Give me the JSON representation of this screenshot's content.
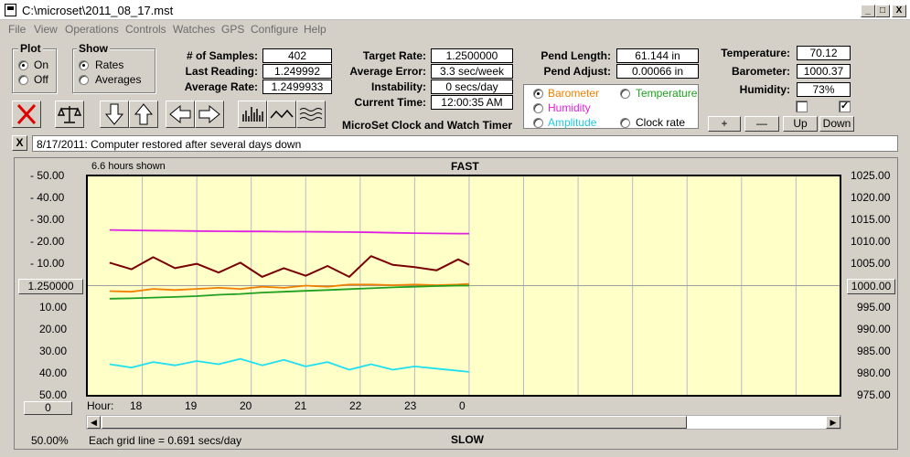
{
  "window": {
    "title": "C:\\microset\\2011_08_17.mst",
    "min": "_",
    "max": "□",
    "close": "X"
  },
  "menu": [
    "File",
    "View",
    "Operations",
    "Controls",
    "Watches",
    "GPS",
    "Configure",
    "Help"
  ],
  "plot_group": {
    "title": "Plot",
    "on": "On",
    "off": "Off",
    "selected": "On"
  },
  "show_group": {
    "title": "Show",
    "rates": "Rates",
    "averages": "Averages",
    "selected": "Rates"
  },
  "stats": {
    "samples_label": "# of Samples:",
    "samples": "402",
    "last_label": "Last Reading:",
    "last": "1.249992",
    "avg_label": "Average Rate:",
    "avg": "1.2499933"
  },
  "rates": {
    "target_label": "Target Rate:",
    "target": "1.2500000",
    "error_label": "Average Error:",
    "error": "3.3 sec/week",
    "instab_label": "Instability:",
    "instab": "0 secs/day",
    "time_label": "Current Time:",
    "time": "12:00:35 AM"
  },
  "app_name": "MicroSet Clock and Watch Timer",
  "pend": {
    "length_label": "Pend Length:",
    "length": "61.144 in",
    "adjust_label": "Pend Adjust:",
    "adjust": "0.00066 in"
  },
  "sensors": {
    "temp_label": "Temperature:",
    "temp": "70.12",
    "baro_label": "Barometer:",
    "baro": "1000.37",
    "humid_label": "Humidity:",
    "humid": "73%"
  },
  "overlay_options": {
    "barometer": "Barometer",
    "temperature": "Temperature",
    "humidity": "Humidity",
    "amplitude": "Amplitude",
    "clock_rate": "Clock rate",
    "selected": "Barometer"
  },
  "scale_buttons": {
    "plus": "+",
    "minus": "—",
    "up": "Up",
    "down": "Down"
  },
  "note": {
    "close": "X",
    "text": "8/17/2011: Computer restored after several days down"
  },
  "chart": {
    "hours_shown": "6.6 hours shown",
    "fast": "FAST",
    "slow": "SLOW",
    "center_rate": "1.250000",
    "center_baro": "1000.00",
    "left_ticks": [
      "-  50.00",
      "-  40.00",
      "-  30.00",
      "-  20.00",
      "-  10.00",
      "10.00",
      "20.00",
      "30.00",
      "40.00",
      "50.00"
    ],
    "right_ticks": [
      "1025.00",
      "1020.00",
      "1015.00",
      "1010.00",
      "1005.00",
      "995.00",
      "990.00",
      "985.00",
      "980.00",
      "975.00"
    ],
    "hour_label": "Hour:",
    "hours": [
      "18",
      "19",
      "20",
      "21",
      "22",
      "23",
      "0"
    ],
    "offset_value": "0",
    "zoom": "50.00%",
    "grid_note": "Each grid line = 0.691 secs/day"
  },
  "colors": {
    "humidity": "#e020e0",
    "rate": "#7a0000",
    "barometer": "#f08000",
    "temperature": "#20a020",
    "amplitude": "#20e0f0",
    "plot_bg": "#ffffc8"
  },
  "chart_data": {
    "type": "line",
    "x": [
      17.4,
      17.8,
      18.2,
      18.6,
      19.0,
      19.4,
      19.8,
      20.2,
      20.6,
      21.0,
      21.4,
      21.8,
      22.2,
      22.6,
      23.0,
      23.4,
      23.8,
      24.0
    ],
    "series": [
      {
        "name": "Humidity",
        "values": [
          25.5,
          25.3,
          25.2,
          25.1,
          25.0,
          24.9,
          24.8,
          24.8,
          24.7,
          24.7,
          24.6,
          24.5,
          24.4,
          24.2,
          24.0,
          23.9,
          23.8,
          23.8
        ]
      },
      {
        "name": "Rate",
        "values": [
          10.5,
          7.5,
          13.0,
          8.0,
          10.0,
          6.0,
          10.5,
          4.0,
          8.0,
          4.5,
          9.0,
          4.0,
          13.5,
          9.5,
          8.5,
          7.0,
          12.0,
          9.5
        ]
      },
      {
        "name": "Barometer",
        "values": [
          -2.5,
          -2.8,
          -1.5,
          -2.0,
          -1.5,
          -1.0,
          -1.5,
          -0.5,
          -1.0,
          0.0,
          -0.5,
          0.5,
          0.5,
          0.2,
          0.5,
          0.2,
          0.5,
          0.8
        ]
      },
      {
        "name": "Temperature",
        "values": [
          -6.0,
          -5.8,
          -5.5,
          -5.2,
          -4.8,
          -4.2,
          -3.8,
          -3.2,
          -2.8,
          -2.4,
          -2.0,
          -1.6,
          -1.2,
          -0.8,
          -0.5,
          -0.2,
          0.0,
          0.0
        ]
      },
      {
        "name": "Amplitude",
        "values": [
          -36.0,
          -37.5,
          -35.0,
          -36.5,
          -34.5,
          -36.0,
          -33.5,
          -36.5,
          -34.0,
          -37.0,
          -35.0,
          -38.5,
          -36.0,
          -38.5,
          -37.0,
          -38.0,
          -39.0,
          -39.5
        ]
      }
    ],
    "ylim": [
      -50,
      50
    ],
    "y2lim": [
      975,
      1025
    ],
    "x_range": [
      17.4,
      24.0
    ],
    "grid": true
  }
}
